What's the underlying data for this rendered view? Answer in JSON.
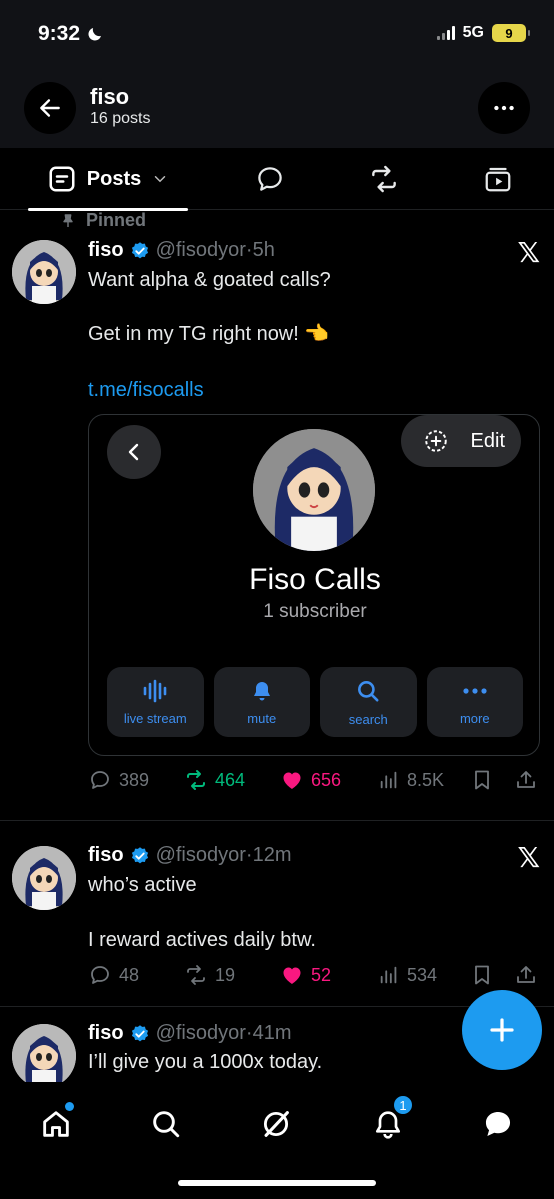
{
  "status": {
    "time": "9:32",
    "network": "5G",
    "battery": "9"
  },
  "header": {
    "name": "fiso",
    "post_count": "16 posts"
  },
  "tabs": {
    "posts_label": "Posts"
  },
  "pinned_label": "Pinned",
  "posts": [
    {
      "name": "fiso",
      "handle": "@fisodyor",
      "sep": "·",
      "time": "5h",
      "text_line1": "Want alpha & goated calls?",
      "text_line2": "Get in my TG right now! 👈",
      "link": "t.me/fisocalls",
      "card": {
        "edit_label": "Edit",
        "title": "Fiso Calls",
        "subtitle": "1 subscriber",
        "buttons": [
          "live stream",
          "mute",
          "search",
          "more"
        ]
      },
      "replies": "389",
      "reposts": "464",
      "likes": "656",
      "views": "8.5K"
    },
    {
      "name": "fiso",
      "handle": "@fisodyor",
      "sep": "·",
      "time": "12m",
      "text_line1": "who’s active",
      "text_line2": "I reward actives daily btw.",
      "replies": "48",
      "reposts": "19",
      "likes": "52",
      "views": "534"
    },
    {
      "name": "fiso",
      "handle": "@fisodyor",
      "sep": "·",
      "time": "41m",
      "text_line1": "I’ll give you a 1000x today."
    }
  ],
  "nav": {
    "notifications_badge": "1"
  },
  "colors": {
    "accent": "#1d9bf0",
    "like": "#f91880",
    "repost": "#00ba7c",
    "muted": "#71767b"
  }
}
